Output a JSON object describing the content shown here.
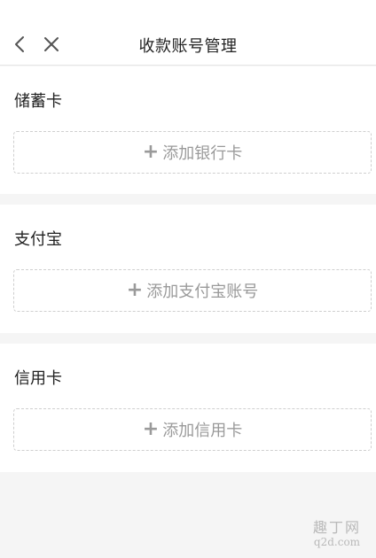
{
  "header": {
    "title": "收款账号管理",
    "back_icon": "chevron-left-icon",
    "close_icon": "close-icon"
  },
  "sections": [
    {
      "label": "储蓄卡",
      "add_label": "添加银行卡"
    },
    {
      "label": "支付宝",
      "add_label": "添加支付宝账号"
    },
    {
      "label": "信用卡",
      "add_label": "添加信用卡"
    }
  ],
  "add_prefix": "+",
  "watermark": {
    "top": "趣丁网",
    "bottom": "q2d.com"
  },
  "colors": {
    "background": "#f5f5f5",
    "panel": "#ffffff",
    "dashed_border": "#cfcfcf",
    "muted_text": "#9a9a9a"
  }
}
